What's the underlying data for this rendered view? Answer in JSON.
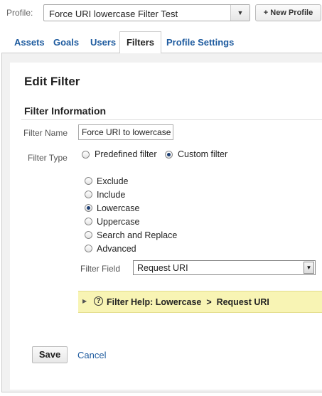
{
  "header": {
    "profile_label": "Profile:",
    "profile_value": "Force URI lowercase Filter Test",
    "new_profile_label": "+ New Profile"
  },
  "tabs": [
    {
      "label": "Assets",
      "active": false
    },
    {
      "label": "Goals",
      "active": false
    },
    {
      "label": "Users",
      "active": false
    },
    {
      "label": "Filters",
      "active": true
    },
    {
      "label": "Profile Settings",
      "active": false
    }
  ],
  "page": {
    "title": "Edit Filter",
    "section_title": "Filter Information"
  },
  "form": {
    "filter_name_label": "Filter Name",
    "filter_name_value": "Force URI to lowercase",
    "filter_type_label": "Filter Type",
    "filter_type_options": [
      {
        "label": "Predefined filter",
        "selected": false
      },
      {
        "label": "Custom filter",
        "selected": true
      }
    ],
    "custom_options": [
      {
        "label": "Exclude",
        "selected": false
      },
      {
        "label": "Include",
        "selected": false
      },
      {
        "label": "Lowercase",
        "selected": true
      },
      {
        "label": "Uppercase",
        "selected": false
      },
      {
        "label": "Search and Replace",
        "selected": false
      },
      {
        "label": "Advanced",
        "selected": false
      }
    ],
    "filter_field_label": "Filter Field",
    "filter_field_value": "Request URI"
  },
  "help": {
    "text": "Filter Help: Lowercase  >  Request URI"
  },
  "actions": {
    "save_label": "Save",
    "cancel_label": "Cancel"
  }
}
